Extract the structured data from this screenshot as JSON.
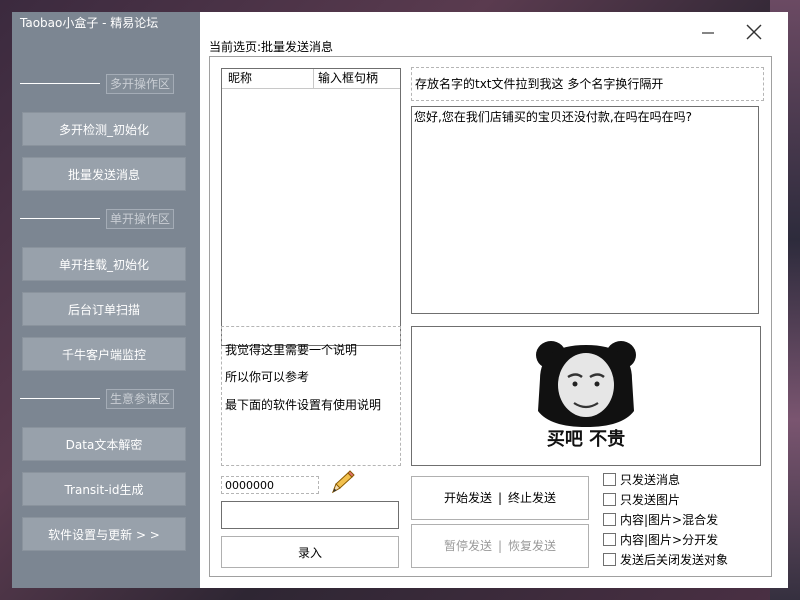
{
  "app_title": "Taobao小盒子 - 精易论坛",
  "sidebar": {
    "sections": [
      "多开操作区",
      "单开操作区",
      "生意参谋区"
    ],
    "buttons": [
      "多开检测_初始化",
      "批量发送消息",
      "单开挂载_初始化",
      "后台订单扫描",
      "千牛客户端监控",
      "Data文本解密",
      "Transit-id生成",
      "软件设置与更新 > >"
    ]
  },
  "main": {
    "current_page_label": "当前选页:批量发送消息",
    "list": {
      "col_nickname": "昵称",
      "col_input_handle": "输入框句柄"
    },
    "file_drop_hint": "存放名字的txt文件拉到我这 多个名字换行隔开",
    "message_text": "您好,您在我们店铺买的宝贝还没付款,在吗在吗在吗?",
    "notes": [
      "我觉得这里需要一个说明",
      "所以你可以参考",
      "最下面的软件设置有使用说明"
    ],
    "image_caption": "买吧 不贵",
    "id_value": "0000000",
    "record_label": "录入",
    "send": {
      "start": "开始发送",
      "stop": "终止发送",
      "pause": "暂停发送",
      "resume": "恢复发送",
      "separator": "|"
    },
    "options": [
      "只发送消息",
      "只发送图片",
      "内容|图片>混合发",
      "内容|图片>分开发",
      "发送后关闭发送对象"
    ]
  },
  "icons": {
    "minimize": "minimize-icon",
    "close": "close-icon",
    "pencil": "pencil-icon"
  }
}
